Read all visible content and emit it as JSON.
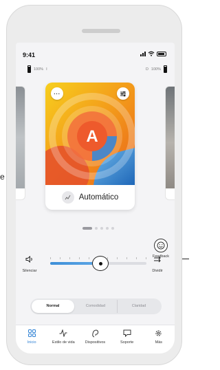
{
  "status_bar": {
    "time": "9:41"
  },
  "hearing_aids": {
    "left_battery": "100%",
    "left_side": "I",
    "right_side": "D",
    "right_battery": "100%"
  },
  "program_card": {
    "title": "Automático",
    "letter": "A",
    "more_label": "···"
  },
  "pager": {
    "active_index": 0,
    "count": 5
  },
  "feedback": {
    "label": "Feedback"
  },
  "volume": {
    "mute_label": "Silenciar",
    "split_label": "Dividir",
    "level": 0.52
  },
  "sound_modes": {
    "tabs": [
      "Normal",
      "Comodidad",
      "Claridad"
    ],
    "active": 0
  },
  "bottom_nav": {
    "items": [
      {
        "label": "Inicio",
        "icon": "home-grid-icon",
        "active": true
      },
      {
        "label": "Estilo de vida",
        "icon": "activity-icon",
        "active": false
      },
      {
        "label": "Dispositivos",
        "icon": "hearing-aid-icon",
        "active": false
      },
      {
        "label": "Soporte",
        "icon": "chat-bubble-icon",
        "active": false
      },
      {
        "label": "Más",
        "icon": "gear-icon",
        "active": false
      }
    ]
  },
  "annotations": {
    "left_fragment": "e"
  },
  "colors": {
    "accent": "#2b7fd4",
    "slider_fill": "#3d8fd8",
    "card_orange": "#f08a1c",
    "card_yellow": "#f4c41a",
    "card_blue": "#2a78c8"
  }
}
